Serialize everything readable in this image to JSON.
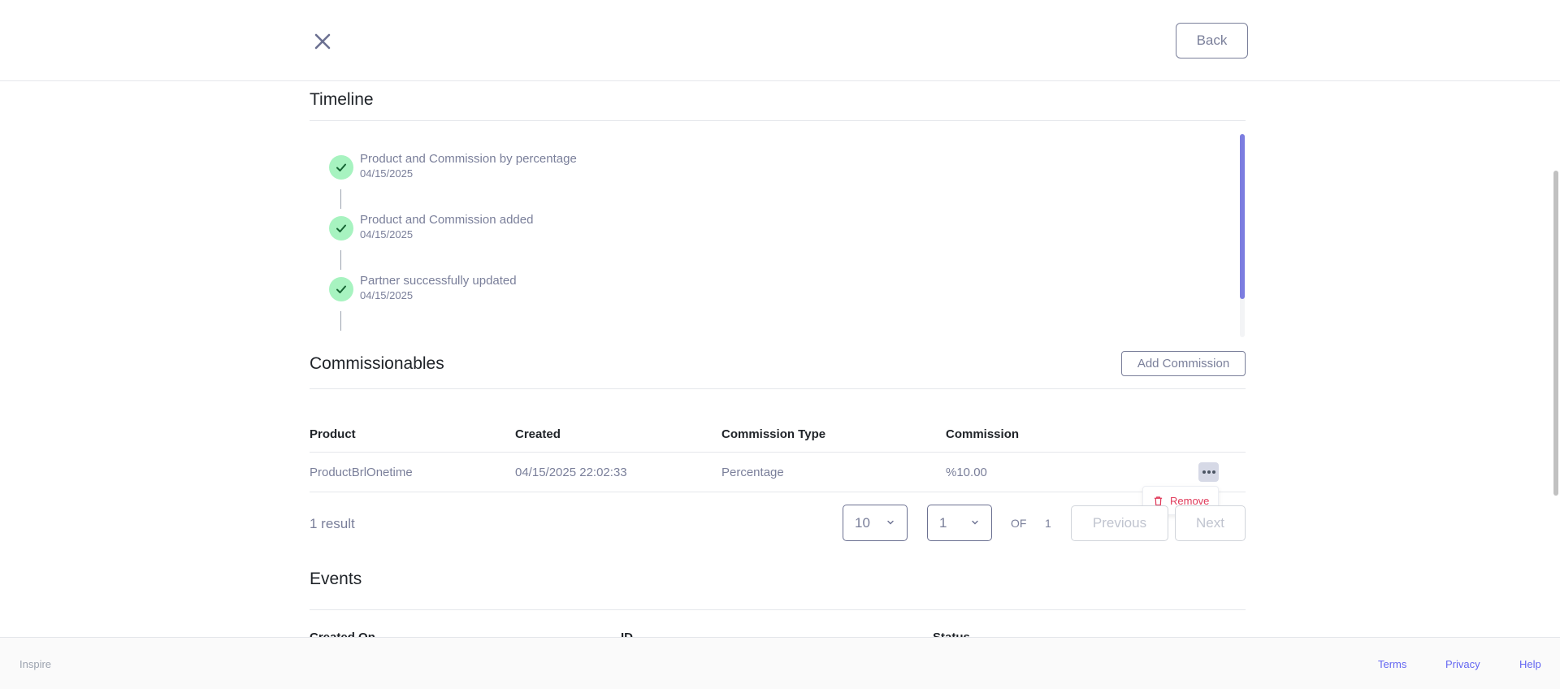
{
  "header": {
    "back_label": "Back"
  },
  "timeline": {
    "title": "Timeline",
    "items": [
      {
        "text": "Product and Commission by percentage",
        "date": "04/15/2025"
      },
      {
        "text": "Product and Commission added",
        "date": "04/15/2025"
      },
      {
        "text": "Partner successfully updated",
        "date": "04/15/2025"
      }
    ]
  },
  "commissionables": {
    "title": "Commissionables",
    "add_label": "Add Commission",
    "columns": [
      "Product",
      "Created",
      "Commission Type",
      "Commission"
    ],
    "rows": [
      {
        "product": "ProductBrlOnetime",
        "created": "04/15/2025 22:02:33",
        "type": "Percentage",
        "commission": "%10.00"
      }
    ],
    "row_menu": {
      "remove_label": "Remove"
    },
    "result_count": "1 result",
    "page_size": "10",
    "page": "1",
    "of_label": "OF",
    "total_pages": "1",
    "previous_label": "Previous",
    "next_label": "Next"
  },
  "events": {
    "title": "Events",
    "columns": [
      "Created On",
      "ID",
      "Status"
    ]
  },
  "footer": {
    "brand": "Inspire",
    "links": [
      "Terms",
      "Privacy",
      "Help"
    ]
  },
  "colors": {
    "accent": "#6366f1",
    "muted_text": "#7a7f9a",
    "success_bg": "#a7f3c0",
    "danger": "#e03a5a"
  }
}
